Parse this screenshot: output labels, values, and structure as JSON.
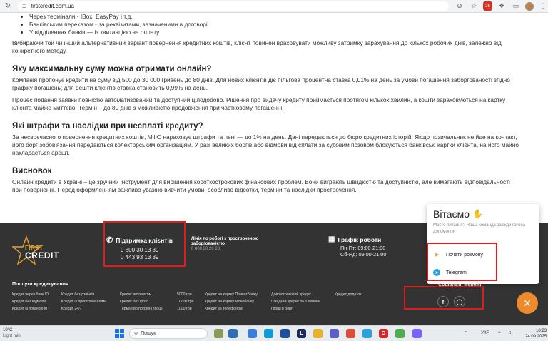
{
  "browser": {
    "url": "firstcredit.com.ua"
  },
  "article": {
    "bullets": [
      "Через термінали - IBox, EasyPay і т.д.",
      "Банківським переказом - за реквізитами, зазначеними в договорі.",
      "У відділеннях банків — із квитанцією на оплату."
    ],
    "intro_para": "Вибираючи той чи інший альтернативний варіант повернення кредитних коштів, клієнт повинен враховувати можливу затримку зарахування до кількох робочих днів, залежно від конкретного методу.",
    "sections": [
      {
        "heading": "Яку максимальну суму можна отримати онлайн?",
        "paras": [
          "Компанія пропонує кредити на суму від 500 до 30 000 гривень до 80 днів. Для нових клієнтів діє пільгова процентна ставка 0,01% на день за умови погашення заборгованості згідно графіку погашень; для решти клієнтів ставка становить 0,99% на день.",
          "Процес подання заявки повністю автоматизований та доступний цілодобово. Рішення про видачу кредиту приймається протягом кількох хвилин, а кошти зараховуються на картку клієнта майже миттєво. Термін – до 80 днів з можливістю продовження при частковому погашенні."
        ]
      },
      {
        "heading": "Які штрафи та наслідки при несплаті кредиту?",
        "paras": [
          "За несвоєчасного повернення кредитних коштів, МФО нараховує штрафи та пені — до 1% на день. Дані передаються до бюро кредитних історій. Якщо позичальник не йде на контакт, його борг зобов'язання передаються колекторським організаціям. У разі великих боргів або відмови від сплати за судовим позовом блокуються банківські картки клієнта, на його майно накладається арешт."
        ]
      },
      {
        "heading": "Висновок",
        "paras": [
          "Онлайн кредити в Україні – це зручний інструмент для вирішення короткострокових фінансових проблем. Вони виграють швидкістю та доступністю, але вимагають відповідальності при поверненні. Перед оформленням важливо уважно вивчити умови, особливо відсотки, терміни та наслідки прострочення."
        ]
      }
    ]
  },
  "footer": {
    "logo_first": "FIRST",
    "logo_credit": "CREDIT",
    "support_title": "Підтримка клієнтів",
    "phone1": "0 800 30 13 39",
    "phone2": "0 443 93 13 39",
    "hours_title": "Лінія по роботі з простроченою заборгованістю",
    "hours_phone": "0 800 30 20 28",
    "schedule_title": "Графік роботи",
    "schedule_weekdays": "Пн-Пт: 09:00-21:00",
    "schedule_weekend": "Сб-Нд: 09:00-21:00",
    "services_title": "Послуги кредитування",
    "social_title": "Соціальні мережі",
    "services_columns": [
      [
        "Кредит через банк ID",
        "Кредит без відмови",
        "Кредит із поганою КІ"
      ],
      [
        "Кредит без дзвінків",
        "Кредит із простроченнями",
        "Кредит 24/7"
      ],
      [
        "Кредит автоматом",
        "Кредит без фото",
        "Терміново потрібні гроші"
      ],
      [
        "5000 грн",
        "10000 грн",
        "1000 грн"
      ],
      [
        "Кредит на картку ПриватБанку",
        "Кредит на картку Монобанку",
        "Кредит за телефоном"
      ],
      [
        "Довгостроковий кредит",
        "Швидкий кредит за 5 хвилин",
        "Гроші в борг"
      ],
      [
        "Кредит додаток"
      ]
    ]
  },
  "chat": {
    "hello": "Вітаємо",
    "subtitle": "Маєте питання? Наша команда завжди готова допомогти!",
    "start_label": "Почати розмову",
    "telegram_label": "Telegram"
  },
  "taskbar": {
    "temp": "10°C",
    "condition": "Light rain",
    "search_placeholder": "Пошук",
    "lang": "УКР",
    "time": "10:23",
    "date": "24.09.2025"
  }
}
